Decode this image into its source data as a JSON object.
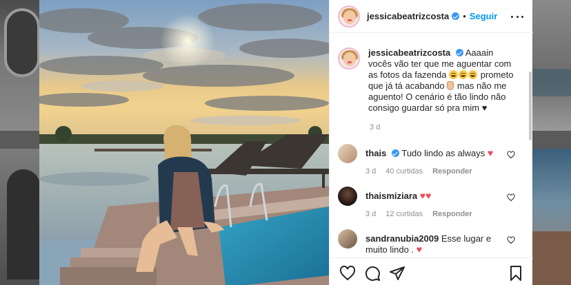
{
  "post": {
    "author": "jessicabeatrizcosta",
    "follow_label": "Seguir",
    "separator": "•",
    "caption_text": "Aaaain vocês vão ter que me aguentar com as fotos da fazenda",
    "caption_text_2": "prometo que já tá acabando",
    "caption_text_3": "mas não me aguento! O cenário é tão lindo não consigo guardar só pra mim",
    "caption_end": "♥",
    "caption_time": "3 d"
  },
  "comments": [
    {
      "user": "thais",
      "verified": true,
      "text": "Tudo lindo as always",
      "emoji": "heart",
      "time": "3 d",
      "likes": "40 curtidas",
      "reply": "Responder"
    },
    {
      "user": "thaismiziara",
      "verified": false,
      "text": "",
      "emoji": "two-hearts",
      "time": "3 d",
      "likes": "12 curtidas",
      "reply": "Responder"
    },
    {
      "user": "sandranubia2009",
      "verified": false,
      "text": "Esse lugar e muito lindo .",
      "emoji": "heart",
      "time": "",
      "likes": "",
      "reply": ""
    }
  ],
  "icons": {
    "like": "heart-outline-icon",
    "comment": "comment-icon",
    "share": "paper-plane-icon",
    "save": "bookmark-icon",
    "more": "more-dots-icon",
    "verified": "verified-badge-icon"
  },
  "colors": {
    "accent": "#0095f6",
    "verified": "#3897f0",
    "heart": "#ed4956",
    "muted": "#8e8e8e"
  }
}
